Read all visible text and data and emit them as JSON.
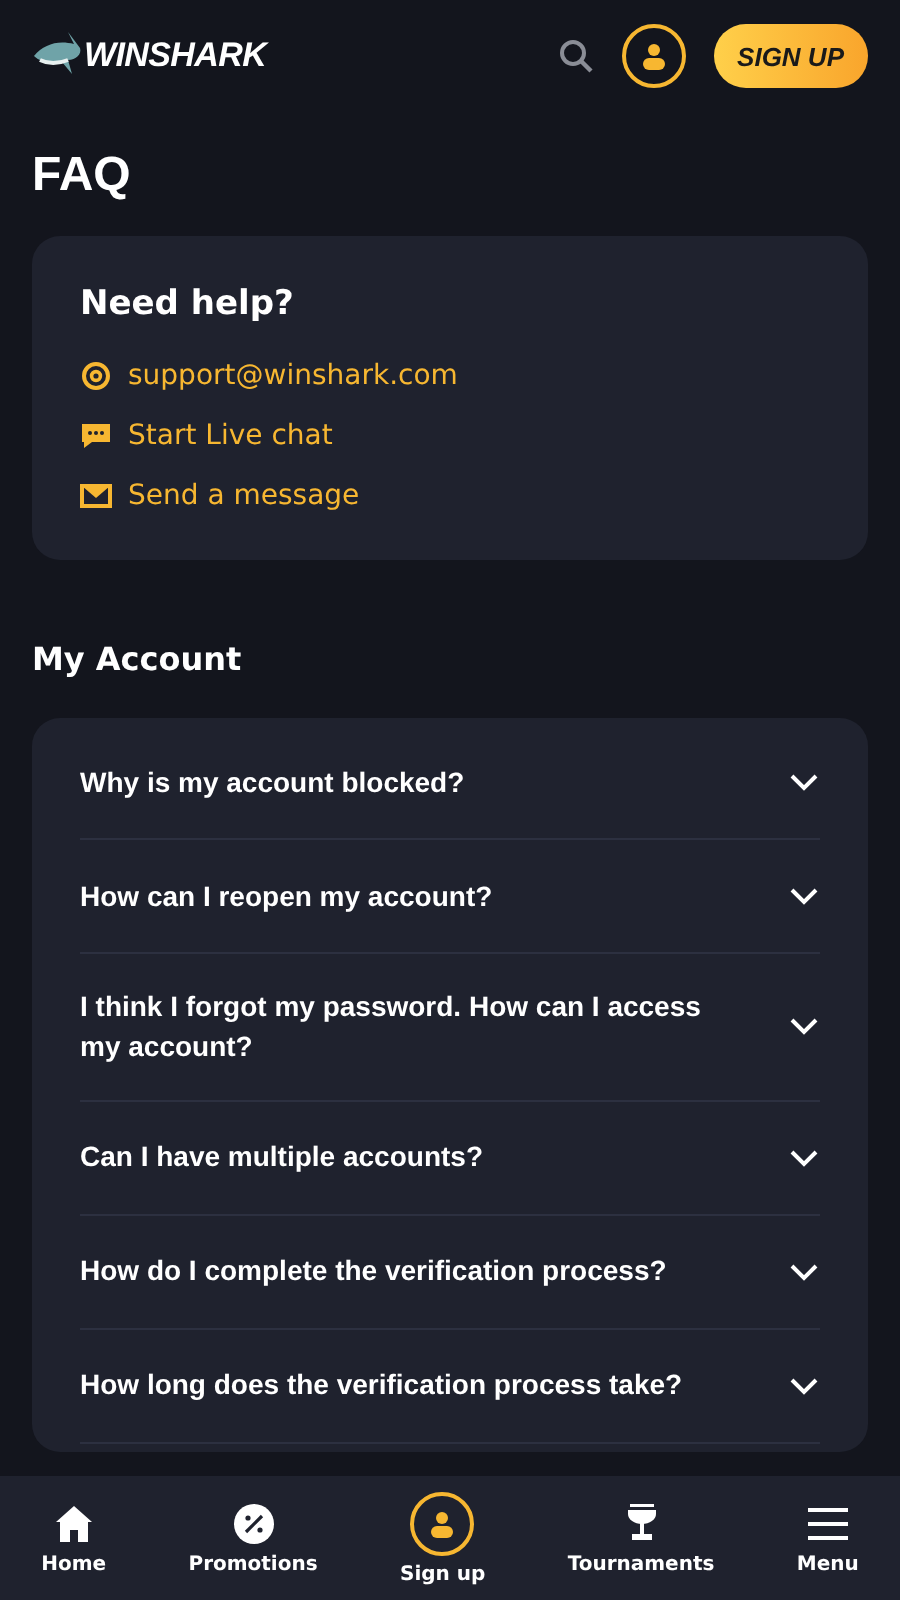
{
  "header": {
    "logo": "WINSHARK",
    "signup_button": "SIGN UP"
  },
  "title": "FAQ",
  "help": {
    "title": "Need help?",
    "contacts": [
      {
        "kind": "email",
        "label": "support@winshark.com"
      },
      {
        "kind": "chat",
        "label": "Start Live chat"
      },
      {
        "kind": "message",
        "label": "Send a message"
      }
    ]
  },
  "section": {
    "title": "My Account",
    "questions": [
      {
        "text": "Why is my account blocked?",
        "expanded": false
      },
      {
        "text": "How can I reopen my account?",
        "expanded": false
      },
      {
        "text": "I think I forgot my password. How can I access my account?",
        "expanded": false
      },
      {
        "text": "Can I have multiple accounts?",
        "expanded": false
      },
      {
        "text": "How do I complete the verification process?",
        "expanded": false
      },
      {
        "text": "How long does the verification process take?",
        "expanded": false
      }
    ]
  },
  "bottom_nav": [
    {
      "kind": "home",
      "label": "Home"
    },
    {
      "kind": "promotions",
      "label": "Promotions"
    },
    {
      "kind": "signup",
      "label": "Sign up"
    },
    {
      "kind": "tournaments",
      "label": "Tournaments"
    },
    {
      "kind": "menu",
      "label": "Menu"
    }
  ]
}
